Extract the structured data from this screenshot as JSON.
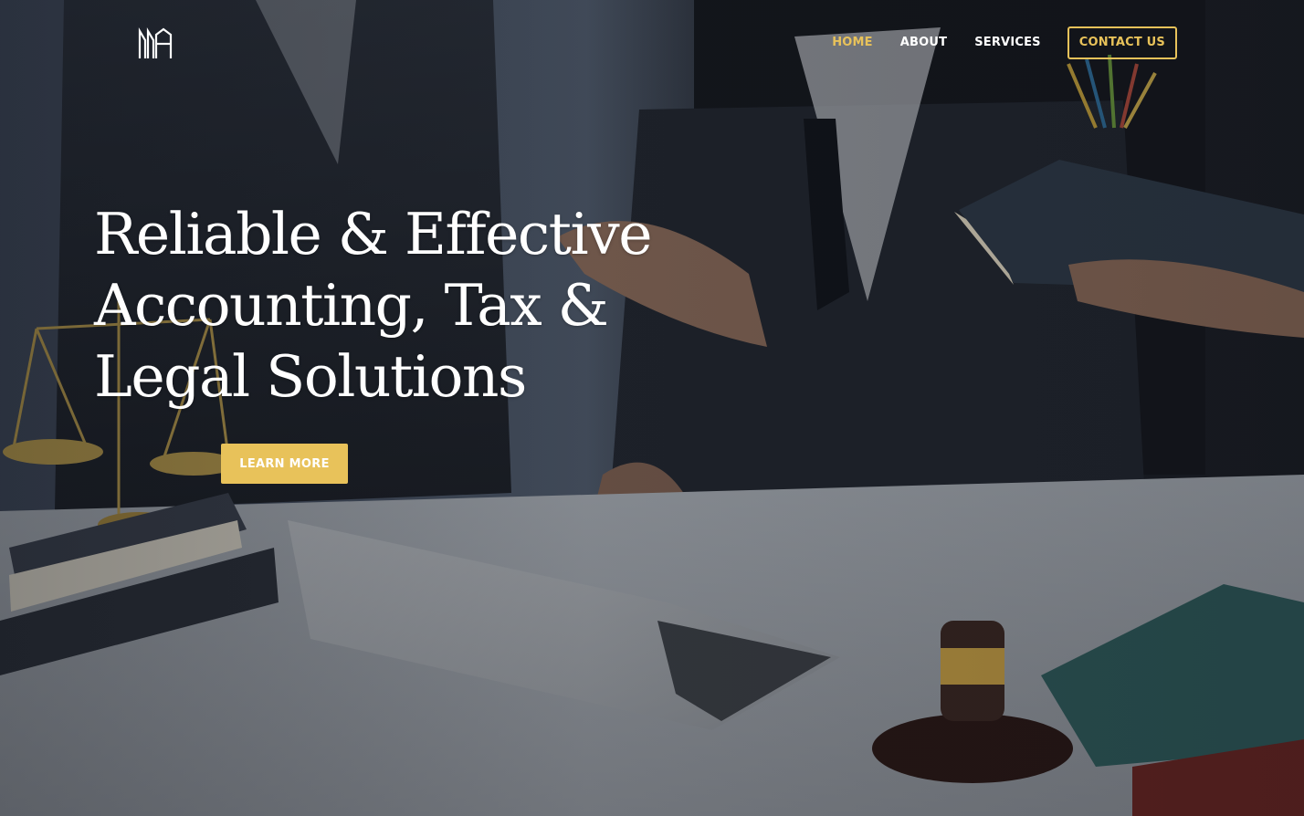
{
  "brand": {
    "logo_text": "MMA",
    "accent_color": "#e8c25a"
  },
  "nav": {
    "items": [
      {
        "label": "HOME",
        "active": true
      },
      {
        "label": "ABOUT",
        "active": false
      },
      {
        "label": "SERVICES",
        "active": false
      }
    ],
    "cta_label": "CONTACT US"
  },
  "hero": {
    "headline_lines": [
      "Reliable & Effective",
      "Accounting, Tax &",
      "Legal Solutions"
    ],
    "button_label": "LEARN MORE",
    "background": "photo-legal-office-meeting"
  }
}
